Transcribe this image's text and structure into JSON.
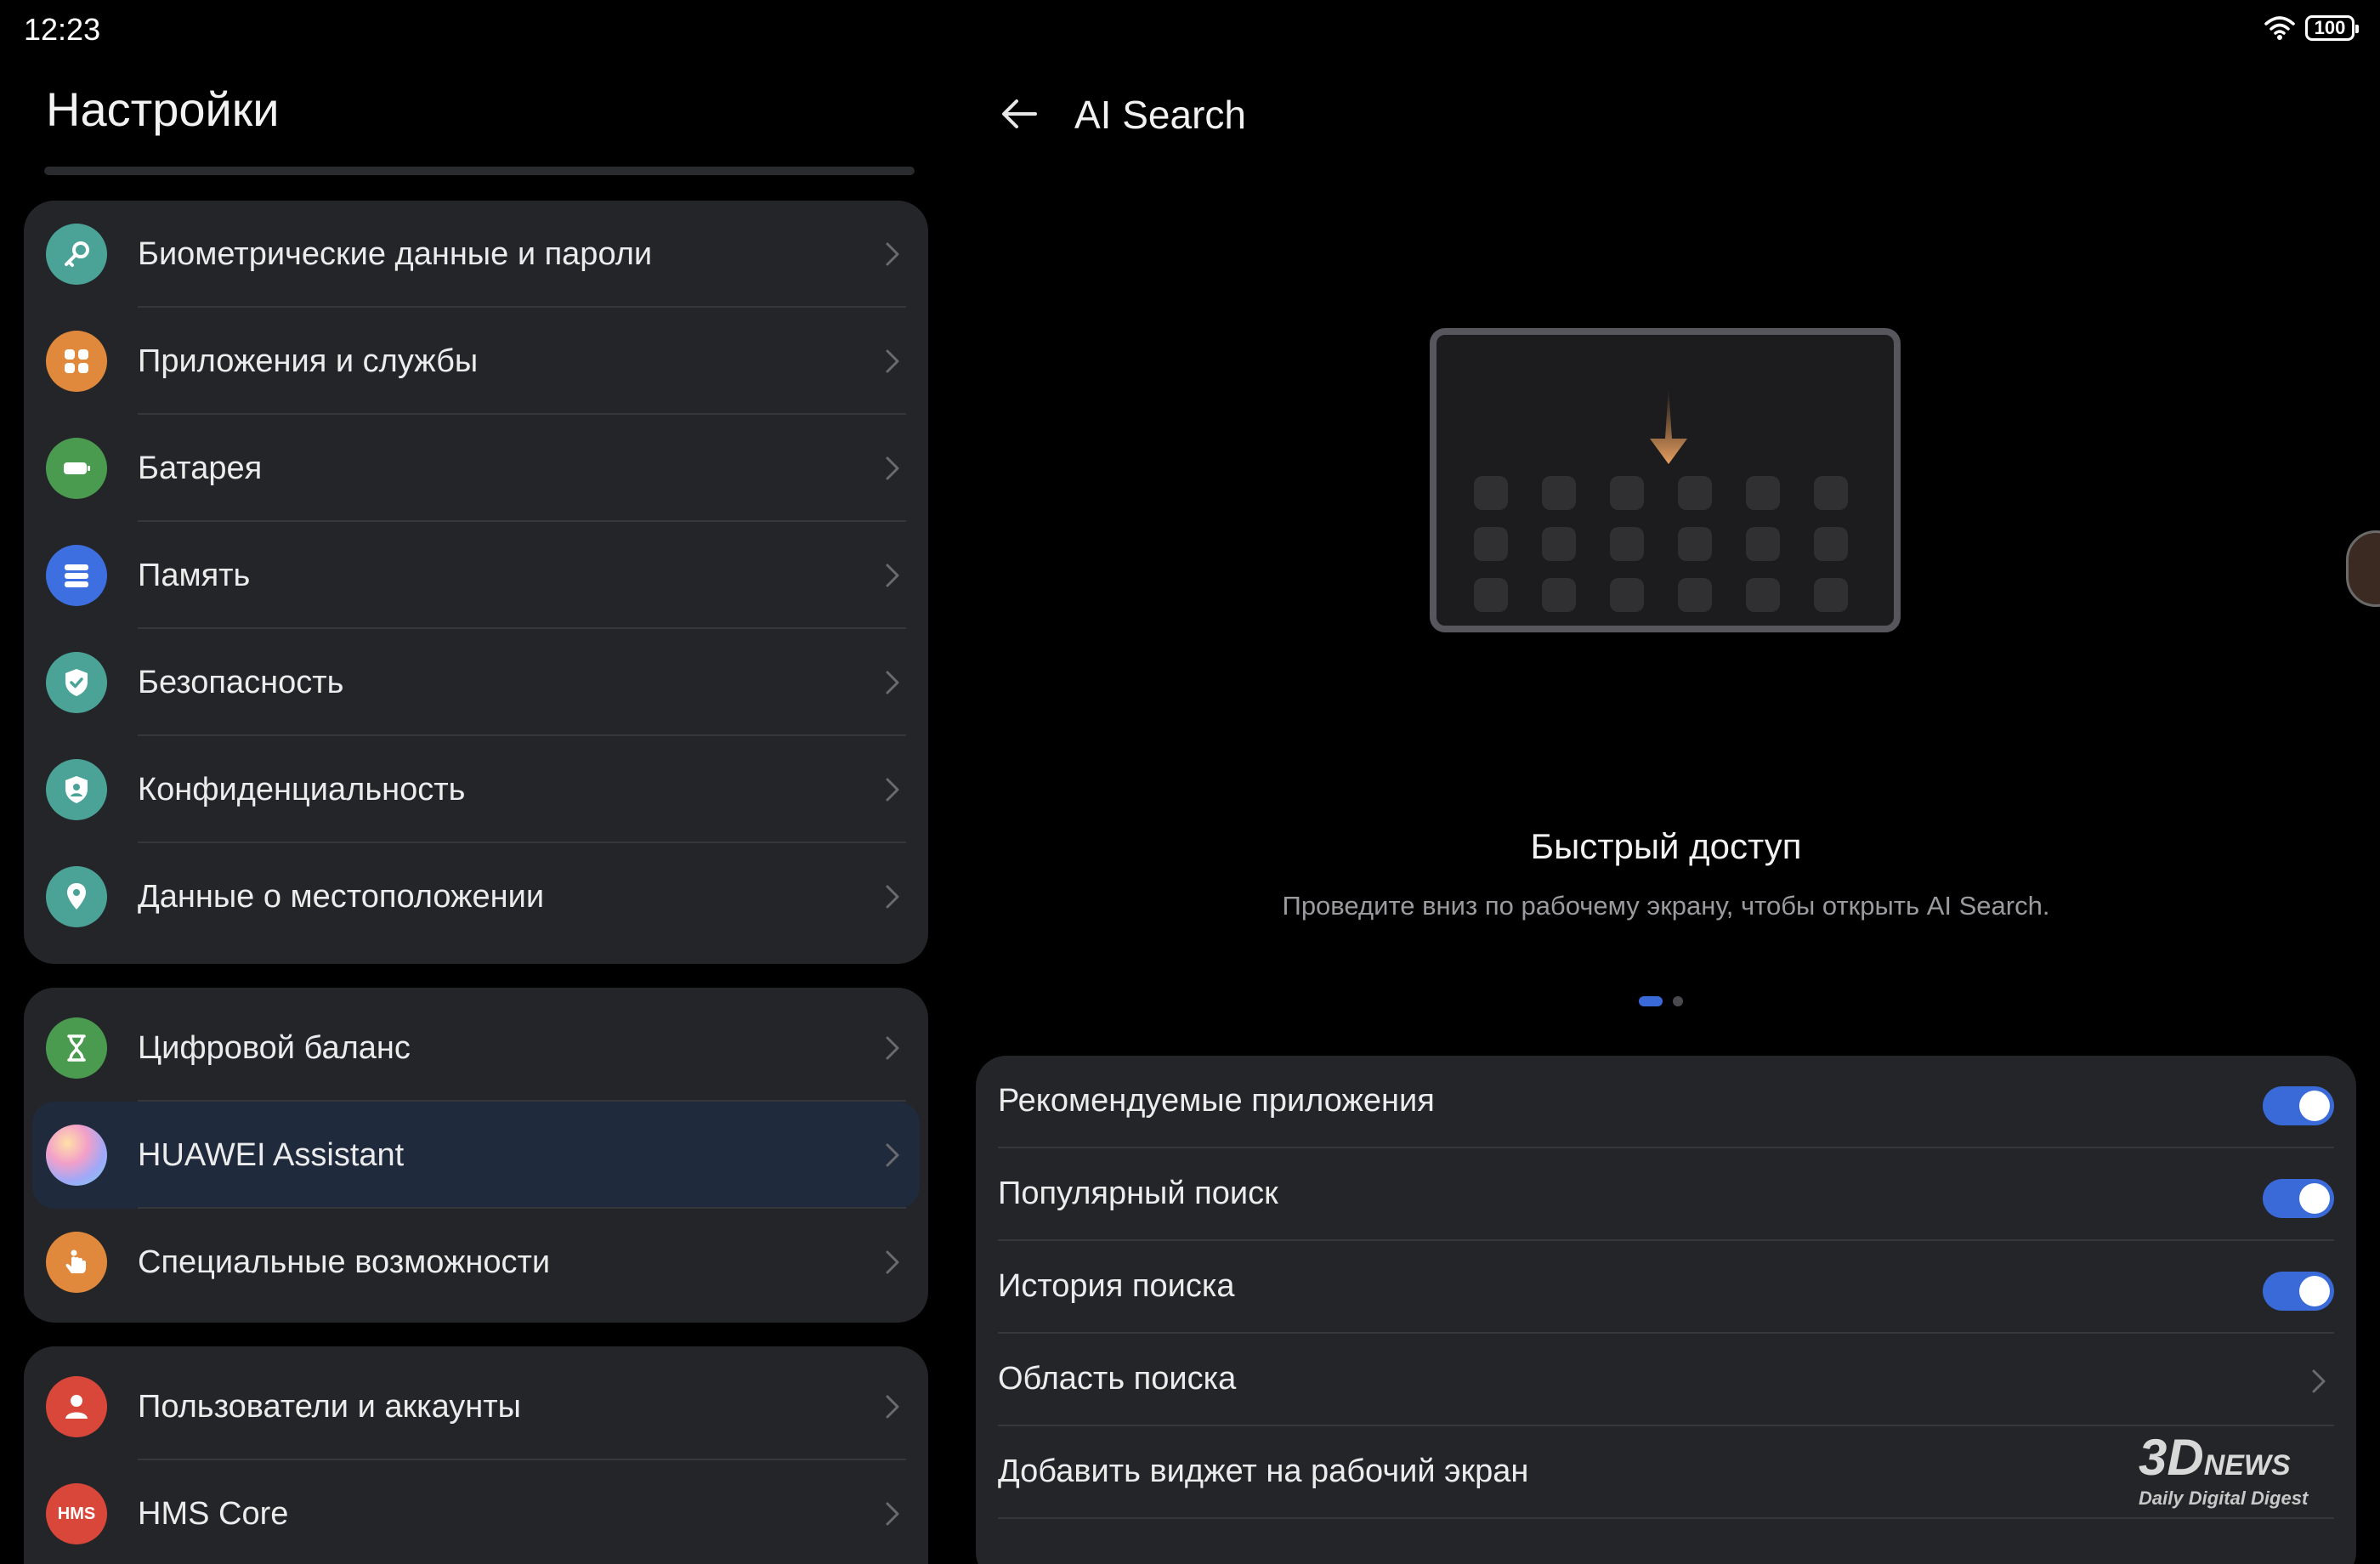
{
  "status_bar": {
    "time": "12:23",
    "battery": "100"
  },
  "left_panel": {
    "title": "Настройки",
    "groups": [
      {
        "items": [
          {
            "label": "Биометрические данные и пароли",
            "icon": "key-icon",
            "color": "#4aa396"
          },
          {
            "label": "Приложения и службы",
            "icon": "apps-icon",
            "color": "#e0893c"
          },
          {
            "label": "Батарея",
            "icon": "battery-icon",
            "color": "#4a9a4f"
          },
          {
            "label": "Память",
            "icon": "storage-icon",
            "color": "#3d6fe0"
          },
          {
            "label": "Безопасность",
            "icon": "shield-icon",
            "color": "#4aa396"
          },
          {
            "label": "Конфиденциальность",
            "icon": "privacy-shield-icon",
            "color": "#4aa396"
          },
          {
            "label": "Данные о местоположении",
            "icon": "location-pin-icon",
            "color": "#4aa396"
          }
        ]
      },
      {
        "items": [
          {
            "label": "Цифровой баланс",
            "icon": "hourglass-icon",
            "color": "#4a9a4f"
          },
          {
            "label": "HUAWEI Assistant",
            "icon": "assistant-orb-icon",
            "color": "#c8a8e8",
            "selected": true
          },
          {
            "label": "Специальные возможности",
            "icon": "hand-icon",
            "color": "#e0893c"
          }
        ]
      },
      {
        "items": [
          {
            "label": "Пользователи и аккаунты",
            "icon": "user-icon",
            "color": "#d9473b"
          },
          {
            "label": "HMS Core",
            "icon": "hms-icon",
            "icon_text": "HMS",
            "color": "#d9473b"
          }
        ]
      }
    ]
  },
  "right_panel": {
    "title": "AI Search",
    "quick_access": {
      "title": "Быстрый доступ",
      "subtitle": "Проведите вниз по рабочему экрану, чтобы открыть AI Search."
    },
    "settings": [
      {
        "label": "Рекомендуемые приложения",
        "type": "toggle",
        "on": true
      },
      {
        "label": "Популярный поиск",
        "type": "toggle",
        "on": true
      },
      {
        "label": "История поиска",
        "type": "toggle",
        "on": true
      },
      {
        "label": "Область поиска",
        "type": "link"
      },
      {
        "label": "Добавить виджет на рабочий экран",
        "type": "none"
      }
    ]
  },
  "watermark": {
    "brand": "3D",
    "brand_suffix": "NEWS",
    "tagline": "Daily Digital Digest"
  },
  "colors": {
    "accent": "#3a6ad8",
    "card": "#242528",
    "background": "#000000"
  }
}
